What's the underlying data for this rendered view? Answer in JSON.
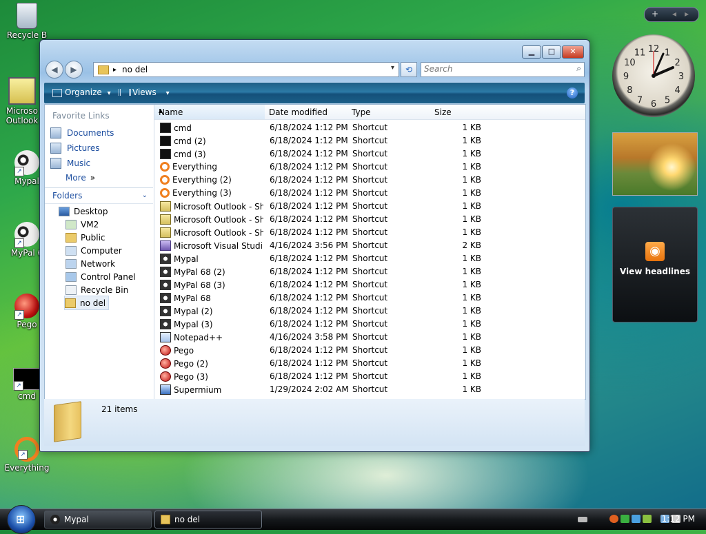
{
  "desktop": {
    "icons": [
      {
        "label": "Recycle B",
        "icon": "recycle-bin-icon"
      },
      {
        "label": "Microso Outlook",
        "icon": "outlook-icon"
      },
      {
        "label": "Mypal",
        "icon": "mypal-icon"
      },
      {
        "label": "MyPal 6",
        "icon": "mypal-icon"
      },
      {
        "label": "Pego",
        "icon": "pego-icon"
      },
      {
        "label": "cmd",
        "icon": "cmd-icon"
      },
      {
        "label": "Everything",
        "icon": "everything-icon"
      }
    ]
  },
  "gadgets": {
    "bar_add": "+",
    "bar_prev": "◂",
    "bar_next": "▸",
    "clock_numbers": [
      "12",
      "1",
      "2",
      "3",
      "4",
      "5",
      "6",
      "7",
      "8",
      "9",
      "10",
      "11"
    ],
    "feed_label": "View headlines"
  },
  "window": {
    "controls": {
      "minimize": "▁",
      "maximize": "□",
      "close": "✕"
    },
    "nav": {
      "back": "◀",
      "forward": "▶"
    },
    "address": {
      "sep": "▸",
      "path": "no del",
      "dropdown": "▾"
    },
    "refresh": "⟲",
    "search": {
      "placeholder": "Search",
      "icon": "magnifier-icon"
    },
    "toolbar": {
      "organize": "Organize",
      "views": "Views",
      "dropdown": "▾",
      "help": "?"
    },
    "sidebar": {
      "favorites_title": "Favorite Links",
      "favorites": [
        "Documents",
        "Pictures",
        "Music",
        "More"
      ],
      "more_chevron": "»",
      "folders_title": "Folders",
      "folders_chevron": "⌄",
      "tree": [
        {
          "label": "Desktop",
          "indent": 0,
          "icon": "desktop-icon"
        },
        {
          "label": "VM2",
          "indent": 1,
          "icon": "user-folder-icon"
        },
        {
          "label": "Public",
          "indent": 1,
          "icon": "folder-icon"
        },
        {
          "label": "Computer",
          "indent": 1,
          "icon": "computer-icon"
        },
        {
          "label": "Network",
          "indent": 1,
          "icon": "network-icon"
        },
        {
          "label": "Control Panel",
          "indent": 1,
          "icon": "control-panel-icon"
        },
        {
          "label": "Recycle Bin",
          "indent": 1,
          "icon": "recycle-bin-icon"
        },
        {
          "label": "no del",
          "indent": 1,
          "icon": "folder-icon",
          "selected": true
        }
      ]
    },
    "columns": [
      "Name",
      "Date modified",
      "Type",
      "Size"
    ],
    "sort_arrow": "▲",
    "files": [
      {
        "name": "cmd",
        "date": "6/18/2024 1:12 PM",
        "type": "Shortcut",
        "size": "1 KB",
        "icon": "cmd"
      },
      {
        "name": "cmd (2)",
        "date": "6/18/2024 1:12 PM",
        "type": "Shortcut",
        "size": "1 KB",
        "icon": "cmd"
      },
      {
        "name": "cmd (3)",
        "date": "6/18/2024 1:12 PM",
        "type": "Shortcut",
        "size": "1 KB",
        "icon": "cmd"
      },
      {
        "name": "Everything",
        "date": "6/18/2024 1:12 PM",
        "type": "Shortcut",
        "size": "1 KB",
        "icon": "ev"
      },
      {
        "name": "Everything (2)",
        "date": "6/18/2024 1:12 PM",
        "type": "Shortcut",
        "size": "1 KB",
        "icon": "ev"
      },
      {
        "name": "Everything (3)",
        "date": "6/18/2024 1:12 PM",
        "type": "Shortcut",
        "size": "1 KB",
        "icon": "ev"
      },
      {
        "name": "Microsoft Outlook - Sh...",
        "date": "6/18/2024 1:12 PM",
        "type": "Shortcut",
        "size": "1 KB",
        "icon": "ol"
      },
      {
        "name": "Microsoft Outlook - Sh...",
        "date": "6/18/2024 1:12 PM",
        "type": "Shortcut",
        "size": "1 KB",
        "icon": "ol"
      },
      {
        "name": "Microsoft Outlook - Sh...",
        "date": "6/18/2024 1:12 PM",
        "type": "Shortcut",
        "size": "1 KB",
        "icon": "ol"
      },
      {
        "name": "Microsoft Visual Studi...",
        "date": "4/16/2024 3:56 PM",
        "type": "Shortcut",
        "size": "2 KB",
        "icon": "vs"
      },
      {
        "name": "Mypal",
        "date": "6/18/2024 1:12 PM",
        "type": "Shortcut",
        "size": "1 KB",
        "icon": "mp"
      },
      {
        "name": "MyPal 68 (2)",
        "date": "6/18/2024 1:12 PM",
        "type": "Shortcut",
        "size": "1 KB",
        "icon": "mp"
      },
      {
        "name": "MyPal 68 (3)",
        "date": "6/18/2024 1:12 PM",
        "type": "Shortcut",
        "size": "1 KB",
        "icon": "mp"
      },
      {
        "name": "MyPal 68",
        "date": "6/18/2024 1:12 PM",
        "type": "Shortcut",
        "size": "1 KB",
        "icon": "mp"
      },
      {
        "name": "Mypal (2)",
        "date": "6/18/2024 1:12 PM",
        "type": "Shortcut",
        "size": "1 KB",
        "icon": "mp"
      },
      {
        "name": "Mypal (3)",
        "date": "6/18/2024 1:12 PM",
        "type": "Shortcut",
        "size": "1 KB",
        "icon": "mp"
      },
      {
        "name": "Notepad++",
        "date": "4/16/2024 3:58 PM",
        "type": "Shortcut",
        "size": "1 KB",
        "icon": "np"
      },
      {
        "name": "Pego",
        "date": "6/18/2024 1:12 PM",
        "type": "Shortcut",
        "size": "1 KB",
        "icon": "pg"
      },
      {
        "name": "Pego (2)",
        "date": "6/18/2024 1:12 PM",
        "type": "Shortcut",
        "size": "1 KB",
        "icon": "pg"
      },
      {
        "name": "Pego (3)",
        "date": "6/18/2024 1:12 PM",
        "type": "Shortcut",
        "size": "1 KB",
        "icon": "pg"
      },
      {
        "name": "Supermium",
        "date": "1/29/2024 2:02 AM",
        "type": "Shortcut",
        "size": "1 KB",
        "icon": "sp"
      }
    ],
    "status": {
      "count": "21 items"
    }
  },
  "taskbar": {
    "start_glyph": "⊞",
    "tasks": [
      {
        "label": "Mypal",
        "icon": "mypal-icon",
        "active": false
      },
      {
        "label": "no del",
        "icon": "folder-icon",
        "active": true
      }
    ],
    "clock": "1:12 PM"
  }
}
